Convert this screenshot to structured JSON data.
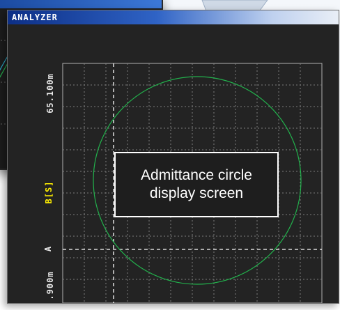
{
  "window": {
    "title": "ANALYZER"
  },
  "plot": {
    "y_axis_max": "65.100m",
    "y_axis_name": "B[S]",
    "y_axis_marker": "A",
    "y_axis_min": ".900m",
    "trace_color": "#22b14c",
    "grid_color": "#8a8a8a",
    "marker_color": "#ffffff"
  },
  "caption": {
    "line1": "Admittance circle",
    "line2": "display screen"
  }
}
